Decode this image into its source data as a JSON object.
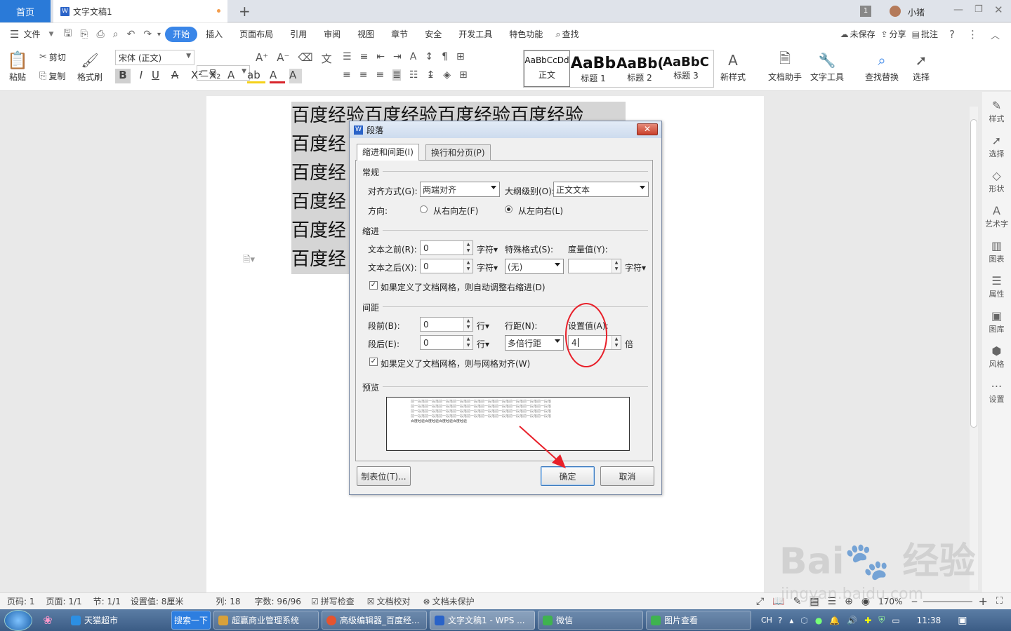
{
  "tabs": {
    "home": "首页",
    "doc": "文字文稿1",
    "count_badge": "1",
    "user": "小猪"
  },
  "menu": {
    "file": "文件",
    "items": [
      "开始",
      "插入",
      "页面布局",
      "引用",
      "审阅",
      "视图",
      "章节",
      "安全",
      "开发工具",
      "特色功能"
    ],
    "search": "查找",
    "unsaved": "未保存",
    "share": "分享",
    "annotate": "批注"
  },
  "ribbon": {
    "paste": "粘贴",
    "cut": "剪切",
    "copy": "复制",
    "format_painter": "格式刷",
    "font_name": "宋体 (正文)",
    "font_size": "二号",
    "styles": [
      {
        "preview": "AaBbCcDd",
        "label": "正文"
      },
      {
        "preview": "AaBb",
        "label": "标题 1"
      },
      {
        "preview": "AaBb(",
        "label": "标题 2"
      },
      {
        "preview": "AaBbC",
        "label": "标题 3"
      }
    ],
    "new_style": "新样式",
    "doc_helper": "文档助手",
    "text_tool": "文字工具",
    "find_replace": "查找替换",
    "select": "选择"
  },
  "document": {
    "lines": [
      "百度经验百度经验百度经验百度经验",
      "百度经",
      "百度经",
      "百度经",
      "百度经",
      "百度经"
    ]
  },
  "right_panel": [
    "样式",
    "选择",
    "形状",
    "艺术字",
    "图表",
    "属性",
    "图库",
    "风格",
    "设置"
  ],
  "dialog": {
    "title": "段落",
    "tab_indent": "缩进和间距(I)",
    "tab_page": "换行和分页(P)",
    "general": "常规",
    "align_label": "对齐方式(G):",
    "align_value": "两端对齐",
    "outline_label": "大纲级别(O):",
    "outline_value": "正文文本",
    "direction_label": "方向:",
    "rtl": "从右向左(F)",
    "ltr": "从左向右(L)",
    "indent": "缩进",
    "before_text_label": "文本之前(R):",
    "before_text_value": "0",
    "after_text_label": "文本之后(X):",
    "after_text_value": "0",
    "unit_char": "字符",
    "special_label": "特殊格式(S):",
    "special_value": "(无)",
    "measure_label": "度量值(Y):",
    "auto_adjust": "如果定义了文档网格，则自动调整右缩进(D)",
    "spacing": "间距",
    "before_label": "段前(B):",
    "before_value": "0",
    "after_label": "段后(E):",
    "after_value": "0",
    "unit_line": "行",
    "line_spacing_label": "行距(N):",
    "line_spacing_value": "多倍行距",
    "set_value_label": "设置值(A):",
    "set_value": "4",
    "unit_times": "倍",
    "snap_grid": "如果定义了文档网格，则与网格对齐(W)",
    "preview": "预览",
    "preview_text": "前一段落前一段落前一段落前一段落前一段落前一段落前一段落前一段落前一段落前一段落",
    "preview_sample": "百度经验百度经验百度经验百度经验",
    "tabs_button": "制表位(T)...",
    "ok": "确定",
    "cancel": "取消"
  },
  "status": {
    "page_no": "页码: 1",
    "pages": "页面: 1/1",
    "section": "节: 1/1",
    "set_value": "设置值: 8厘米",
    "col": "列: 18",
    "words": "字数: 96/96",
    "spell": "拼写检查",
    "proof": "文档校对",
    "protect": "文档未保护",
    "zoom": "170%"
  },
  "taskbar": {
    "items": [
      "天猫超市",
      "搜索一下",
      "超赢商业管理系统",
      "高级编辑器_百度经...",
      "文字文稿1 - WPS ...",
      "微信",
      "图片查看"
    ],
    "lang": "CH",
    "time": "11:38"
  },
  "colors": {
    "accent": "#3a86e8",
    "annotation_red": "#e8202a"
  }
}
